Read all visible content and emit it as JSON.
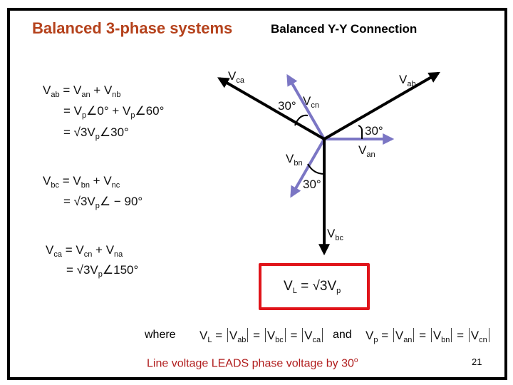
{
  "slide": {
    "title": "Balanced 3-phase systems",
    "subtitle": "Balanced Y-Y Connection",
    "page_number": "21",
    "footer": "Line voltage LEADS phase voltage by 30",
    "footer_sup": "o",
    "colors": {
      "title": "#b5421c",
      "footer": "#b01c1c",
      "phase_vector": "#7b76c4",
      "line_vector": "#000000",
      "highlight_box": "#e0141a"
    }
  },
  "equations": {
    "vab": {
      "lhs": "V",
      "lhs_sub": "ab",
      "line1": [
        "= V",
        "an",
        " + V",
        "nb"
      ],
      "line2": [
        "= V",
        "p",
        "∠0° + V",
        "p",
        "∠60°"
      ],
      "line3": [
        "= √3V",
        "p",
        "∠30°"
      ]
    },
    "vbc": {
      "lhs": "V",
      "lhs_sub": "bc",
      "line1": [
        "= V",
        "bn",
        " + V",
        "nc"
      ],
      "line2": [
        "= √3V",
        "p",
        "∠ − 90°"
      ]
    },
    "vca": {
      "lhs": "V",
      "lhs_sub": "ca",
      "line1": [
        "= V",
        "cn",
        " + V",
        "na"
      ],
      "line2": [
        "= √3V",
        "p",
        "∠150°"
      ]
    },
    "boxed": [
      "V",
      "L",
      " = √3V",
      "p"
    ],
    "where_label": "where",
    "where_eq": [
      "V",
      "L",
      " = ",
      "V",
      "ab",
      " = ",
      "V",
      "bc",
      " = ",
      "V",
      "ca"
    ],
    "and_label": "and",
    "and_eq": [
      "V",
      "p",
      " = ",
      "V",
      "an",
      " = ",
      "V",
      "bn",
      " = ",
      "V",
      "cn"
    ]
  },
  "phasor_diagram": {
    "vectors": [
      {
        "name": "Van",
        "label": "V",
        "sub": "an",
        "type": "phase",
        "angle_deg": 0
      },
      {
        "name": "Vbn",
        "label": "V",
        "sub": "bn",
        "type": "phase",
        "angle_deg": -120
      },
      {
        "name": "Vcn",
        "label": "V",
        "sub": "cn",
        "type": "phase",
        "angle_deg": 120
      },
      {
        "name": "Vab",
        "label": "V",
        "sub": "ab",
        "type": "line",
        "angle_deg": 30
      },
      {
        "name": "Vbc",
        "label": "V",
        "sub": "bc",
        "type": "line",
        "angle_deg": -90
      },
      {
        "name": "Vca",
        "label": "V",
        "sub": "ca",
        "type": "line",
        "angle_deg": 150
      }
    ],
    "angle_labels": [
      "30°",
      "30°",
      "30°"
    ]
  }
}
